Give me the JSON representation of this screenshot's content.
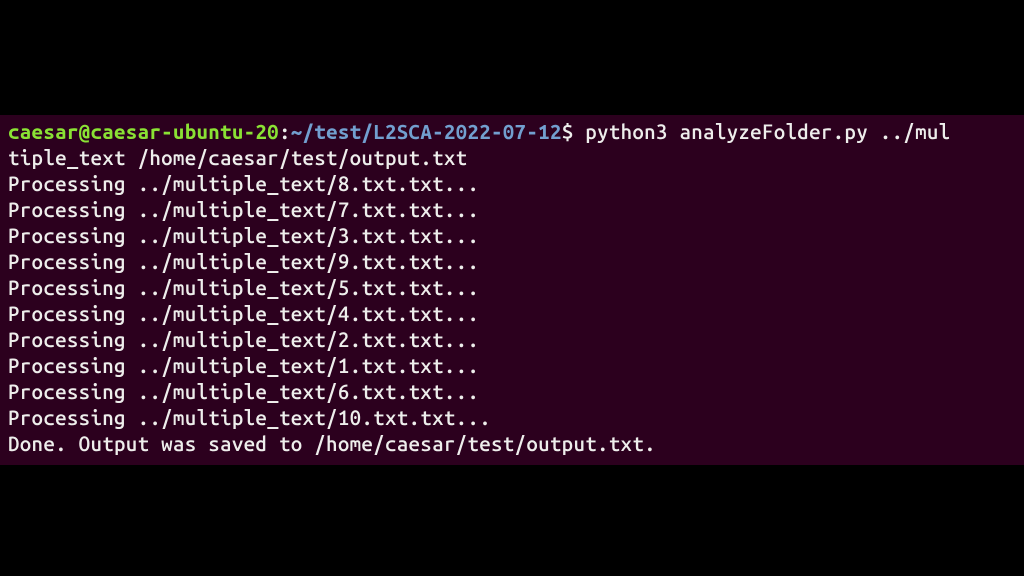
{
  "prompt": {
    "user_host": "caesar@caesar-ubuntu-20",
    "colon": ":",
    "path": "~/test/L2SCA-2022-07-12",
    "dollar": "$ "
  },
  "command_line1": "python3 analyzeFolder.py ../mul",
  "command_line2": "tiple_text /home/caesar/test/output.txt",
  "output_lines": [
    "Processing ../multiple_text/8.txt.txt...",
    "Processing ../multiple_text/7.txt.txt...",
    "Processing ../multiple_text/3.txt.txt...",
    "Processing ../multiple_text/9.txt.txt...",
    "Processing ../multiple_text/5.txt.txt...",
    "Processing ../multiple_text/4.txt.txt...",
    "Processing ../multiple_text/2.txt.txt...",
    "Processing ../multiple_text/1.txt.txt...",
    "Processing ../multiple_text/6.txt.txt...",
    "Processing ../multiple_text/10.txt.txt...",
    "Done. Output was saved to /home/caesar/test/output.txt."
  ]
}
